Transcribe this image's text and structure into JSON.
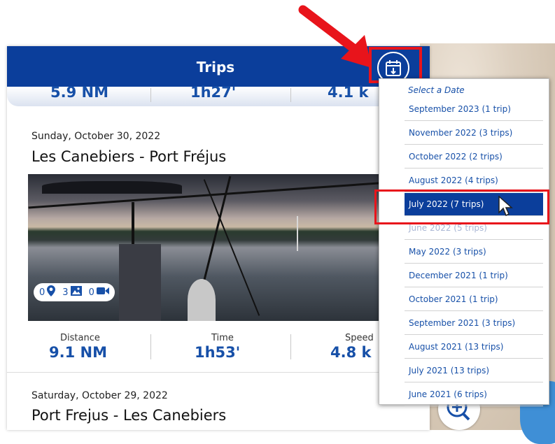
{
  "header": {
    "title": "Trips"
  },
  "top_stats": {
    "distance": "5.9 NM",
    "time": "1h27'",
    "speed": "4.1 k"
  },
  "trips": [
    {
      "date": "Sunday, October 30, 2022",
      "title": "Les Canebiers - Port Fréjus",
      "media": {
        "waypoints": "0",
        "photos": "3",
        "videos": "0"
      },
      "stats": {
        "distance_label": "Distance",
        "distance_value": "9.1 NM",
        "time_label": "Time",
        "time_value": "1h53'",
        "speed_label": "Speed",
        "speed_value": "4.8 k"
      }
    },
    {
      "date": "Saturday, October 29, 2022",
      "title": "Port Frejus - Les Canebiers"
    }
  ],
  "date_menu": {
    "header": "Select a Date",
    "selected_index": 4,
    "items": [
      "September 2023 (1 trip)",
      "November 2022 (3 trips)",
      "October 2022 (2 trips)",
      "August 2022 (4 trips)",
      "July 2022 (7 trips)",
      "June 2022 (5 trips)",
      "May 2022 (3 trips)",
      "December 2021 (1 trip)",
      "October 2021 (1 trip)",
      "September 2021 (3 trips)",
      "August 2021 (13 trips)",
      "July 2021 (13 trips)",
      "June 2021 (6 trips)"
    ]
  },
  "colors": {
    "header": "#0b3e9b",
    "accent": "#1750a8",
    "highlight": "#e8141b"
  },
  "icons": [
    "calendar-icon",
    "pin-icon",
    "photo-icon",
    "video-icon",
    "zoom-in-icon",
    "cursor-icon",
    "arrow-icon"
  ]
}
